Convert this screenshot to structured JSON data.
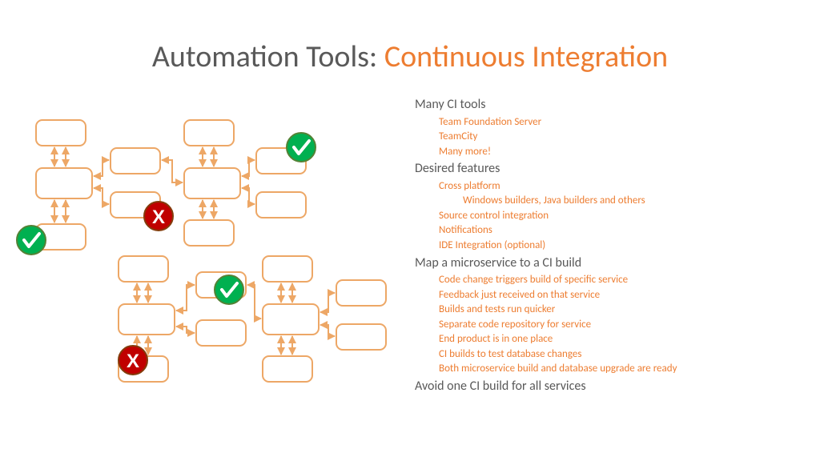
{
  "title": {
    "prefix": "Automation Tools: ",
    "accent": "Continuous Integration"
  },
  "content": {
    "sec1": {
      "heading": "Many CI tools",
      "items": [
        "Team Foundation Server",
        "TeamCity",
        "Many more!"
      ]
    },
    "sec2": {
      "heading": "Desired features",
      "item0": "Cross platform",
      "sub0": "Windows builders, Java builders and others",
      "items_rest": [
        "Source control integration",
        "Notifications",
        "IDE Integration (optional)"
      ]
    },
    "sec3": {
      "heading": "Map a microservice to a CI build",
      "items": [
        "Code change triggers build of specific service",
        "Feedback just received on that service",
        "Builds and tests run quicker",
        "Separate code repository for service",
        "End product is in one place",
        "CI builds to test database changes",
        "Both microservice build and database upgrade are ready"
      ]
    },
    "sec4": {
      "heading": "Avoid one CI build for all services"
    }
  },
  "colors": {
    "accent": "#ed7d31",
    "text": "#595959",
    "green": "#00b050",
    "red": "#c00000",
    "box_stroke": "#eda766"
  }
}
